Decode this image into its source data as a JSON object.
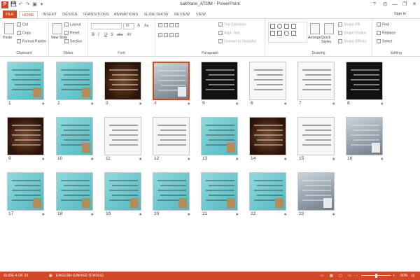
{
  "window": {
    "title": "sakhtare_ATOM - PowerPoint",
    "controls": [
      "?",
      "⊟",
      "—",
      "❐",
      "✕"
    ]
  },
  "quick_access": [
    "💾",
    "↶",
    "↷",
    "▣",
    "▾"
  ],
  "tabs": [
    "FILE",
    "HOME",
    "INSERT",
    "DESIGN",
    "TRANSITIONS",
    "ANIMATIONS",
    "SLIDE SHOW",
    "REVIEW",
    "VIEW"
  ],
  "sign_in": "Sign in",
  "ribbon": {
    "clipboard": {
      "label": "Clipboard",
      "paste": "Paste",
      "cut": "Cut",
      "copy": "Copy",
      "format_painter": "Format Painter"
    },
    "slides": {
      "label": "Slides",
      "new_slide": "New Slide",
      "layout": "Layout",
      "reset": "Reset",
      "section": "Section"
    },
    "font": {
      "label": "Font",
      "size": "18",
      "buttons": [
        "B",
        "I",
        "U",
        "S",
        "abc",
        "AV",
        "Aa",
        "A"
      ]
    },
    "paragraph": {
      "label": "Paragraph",
      "text_direction": "Text Direction",
      "align_text": "Align Text",
      "convert_smartart": "Convert to SmartArt"
    },
    "drawing": {
      "label": "Drawing",
      "arrange": "Arrange",
      "quick_styles": "Quick Styles",
      "shape_fill": "Shape Fill",
      "shape_outline": "Shape Outline",
      "shape_effects": "Shape Effects"
    },
    "editing": {
      "label": "Editing",
      "find": "Find",
      "replace": "Replace",
      "select": "Select"
    }
  },
  "slides": [
    {
      "num": "1",
      "theme": "teal"
    },
    {
      "num": "2",
      "theme": "teal"
    },
    {
      "num": "3",
      "theme": "dark"
    },
    {
      "num": "4",
      "theme": "photo",
      "selected": true
    },
    {
      "num": "5",
      "theme": "black"
    },
    {
      "num": "6",
      "theme": "white"
    },
    {
      "num": "7",
      "theme": "white"
    },
    {
      "num": "8",
      "theme": "black"
    },
    {
      "num": "9",
      "theme": "dark"
    },
    {
      "num": "10",
      "theme": "teal"
    },
    {
      "num": "11",
      "theme": "white"
    },
    {
      "num": "12",
      "theme": "white"
    },
    {
      "num": "13",
      "theme": "teal"
    },
    {
      "num": "14",
      "theme": "dark"
    },
    {
      "num": "15",
      "theme": "white"
    },
    {
      "num": "16",
      "theme": "photo"
    },
    {
      "num": "17",
      "theme": "teal"
    },
    {
      "num": "18",
      "theme": "teal"
    },
    {
      "num": "19",
      "theme": "teal"
    },
    {
      "num": "20",
      "theme": "teal"
    },
    {
      "num": "21",
      "theme": "teal"
    },
    {
      "num": "22",
      "theme": "teal"
    },
    {
      "num": "23",
      "theme": "photo"
    }
  ],
  "transition_mark": "★",
  "status": {
    "slide": "SLIDE 4 OF 23",
    "language": "ENGLISH (UNITED STATES)",
    "zoom": "50%"
  },
  "colors": {
    "accent": "#d24726",
    "teal": "#5fc3c8"
  }
}
